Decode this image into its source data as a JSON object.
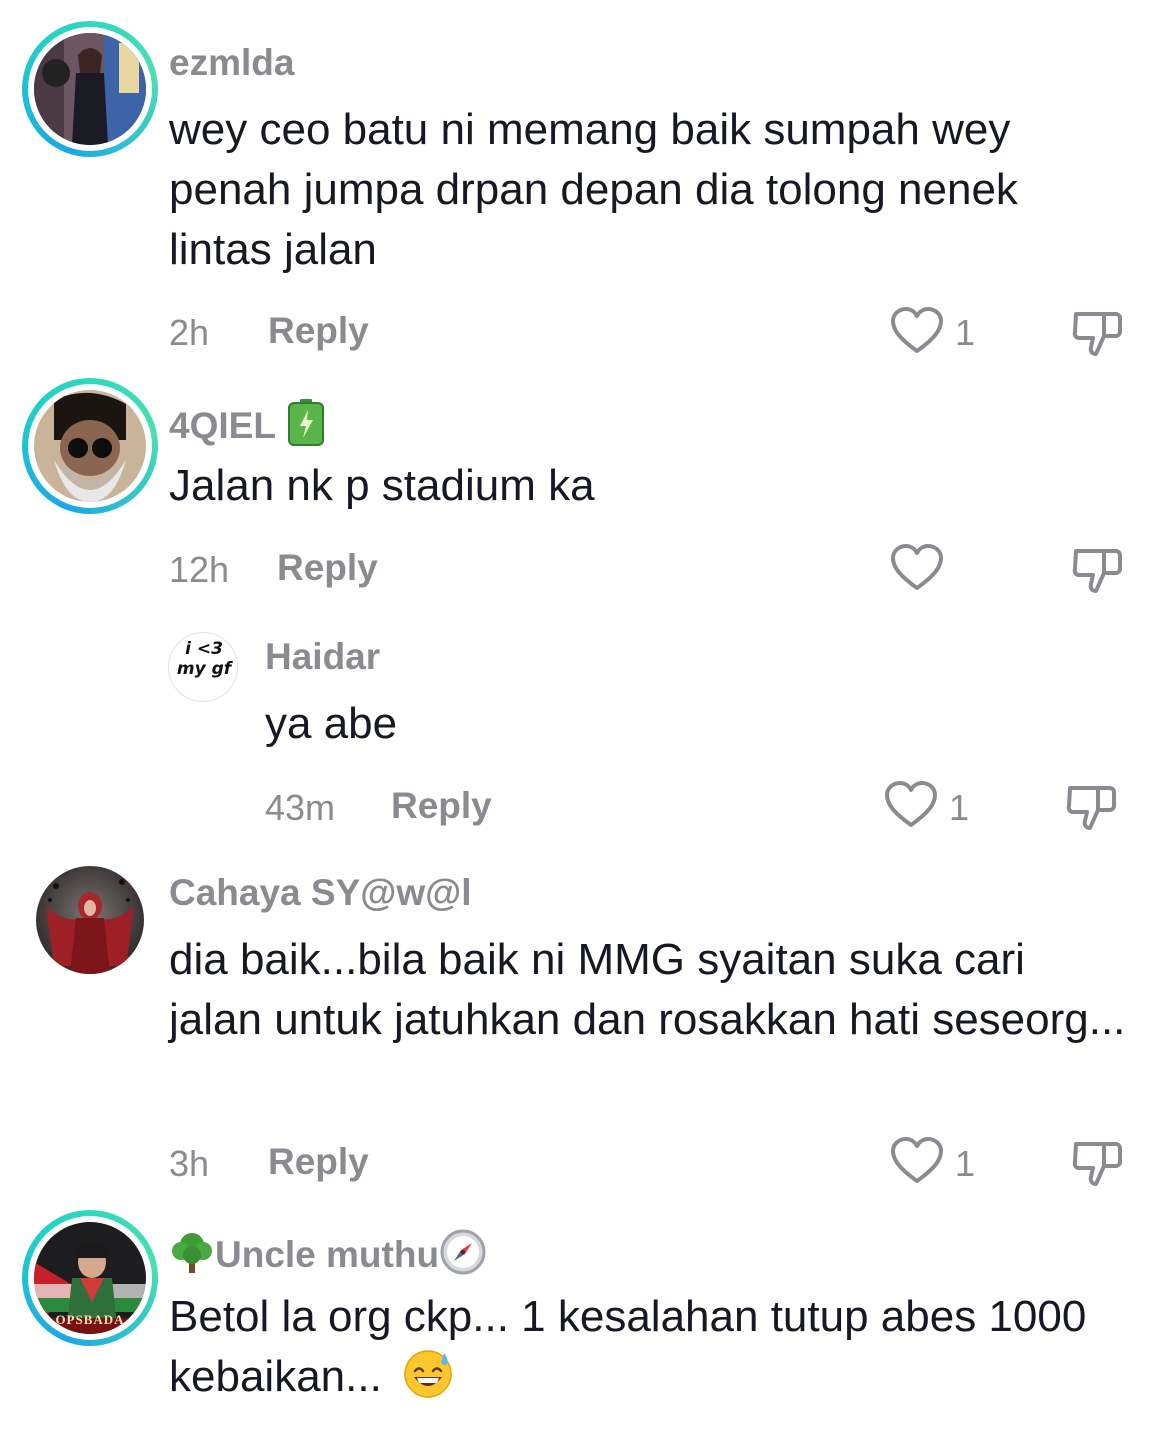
{
  "comments": [
    {
      "username": "ezmlda",
      "text": "wey ceo batu ni memang baik sumpah wey penah jumpa drpan depan dia tolong nenek lintas jalan",
      "time": "2h",
      "reply_label": "Reply",
      "likes": "1",
      "avatar_ring": true
    },
    {
      "username": "4QIEL",
      "username_suffix_icon": "battery-charging-icon",
      "text": "Jalan nk p stadium ka",
      "time": "12h",
      "reply_label": "Reply",
      "likes": "",
      "avatar_ring": true
    },
    {
      "username": "Haidar",
      "text": "ya abe",
      "time": "43m",
      "reply_label": "Reply",
      "likes": "1",
      "avatar_text_1": "i <3",
      "avatar_text_2": "my gf"
    },
    {
      "username": "Cahaya SY@w@l",
      "text": "dia baik...bila baik ni MMG syaitan suka cari jalan untuk jatuhkan dan rosakkan hati seseorg...",
      "time": "3h",
      "reply_label": "Reply",
      "likes": "1",
      "avatar_ring": false
    },
    {
      "username": "Uncle muthu",
      "username_prefix_icon": "tree-icon",
      "username_suffix_icon": "compass-icon",
      "text": "Betol la org ckp... 1 kesalahan tutup abes 1000 kebaikan...",
      "text_suffix_icon": "grinning-sweat-emoji",
      "time": "",
      "avatar_ring": true,
      "avatar_text": "OPSBADA"
    }
  ],
  "colors": {
    "text": "#161823",
    "muted": "#8a8b91",
    "ring_start": "#1aa7e8",
    "ring_end": "#4ae0b0"
  }
}
